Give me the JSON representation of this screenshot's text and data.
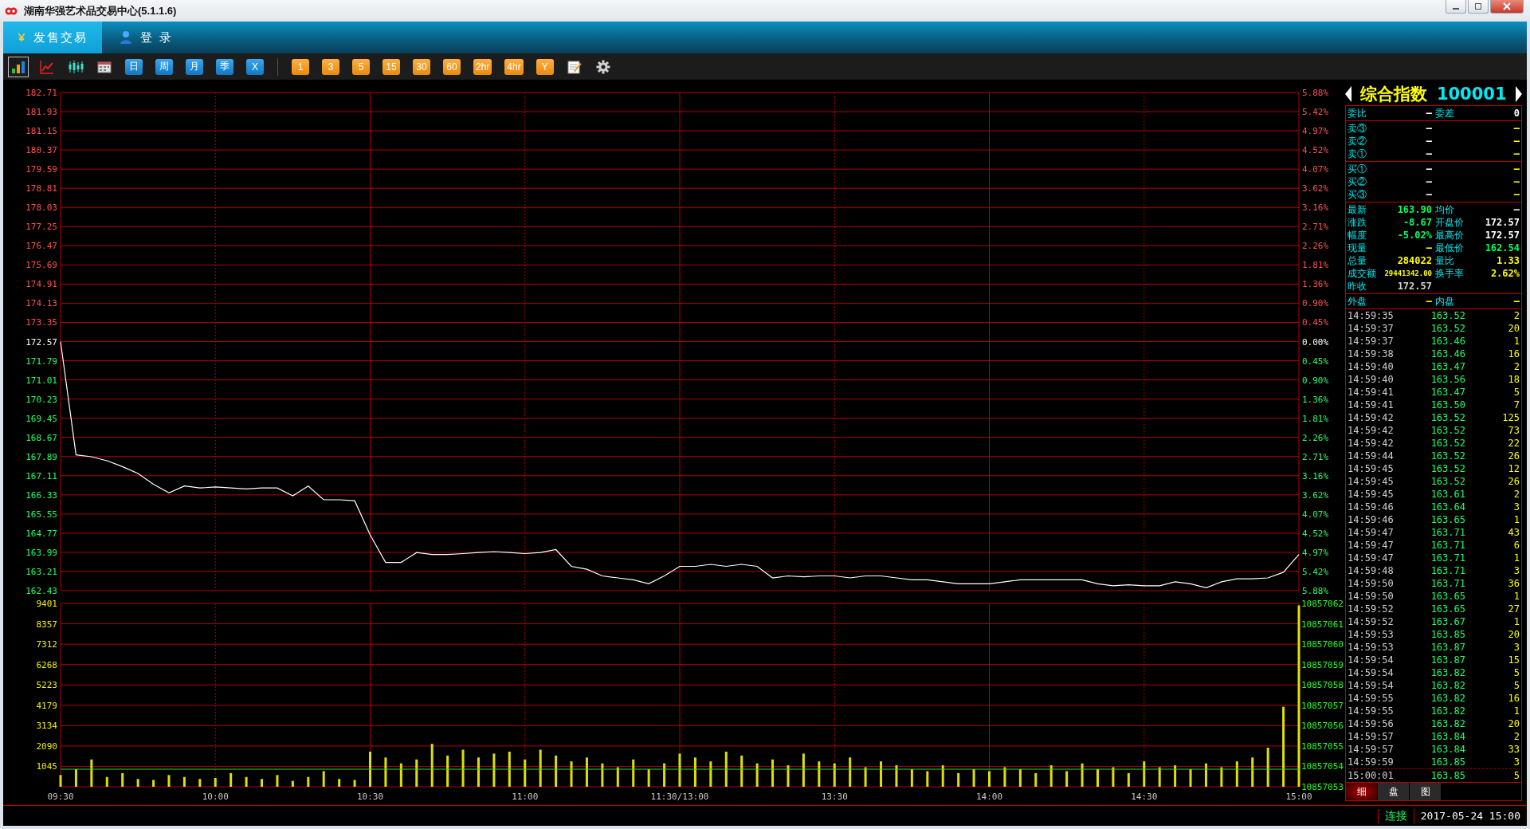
{
  "window": {
    "title": "湖南华强艺术品交易中心(5.1.1.6)"
  },
  "tabs": [
    {
      "label": "发售交易",
      "kind": "yen",
      "selected": true
    },
    {
      "label": "登 录",
      "kind": "user",
      "selected": false
    }
  ],
  "toolbar": {
    "tools": [
      {
        "kind": "bars",
        "selected": true
      },
      {
        "kind": "line",
        "selected": false
      },
      {
        "kind": "candles",
        "selected": false
      },
      {
        "kind": "calendar",
        "selected": false
      }
    ],
    "periods": [
      {
        "label": "日",
        "kind": "blue"
      },
      {
        "label": "周",
        "kind": "blue"
      },
      {
        "label": "月",
        "kind": "blue"
      },
      {
        "label": "季",
        "kind": "blue"
      },
      {
        "label": "X",
        "kind": "blue"
      },
      {
        "label": "1",
        "kind": "orange"
      },
      {
        "label": "3",
        "kind": "orange"
      },
      {
        "label": "5",
        "kind": "orange"
      },
      {
        "label": "15",
        "kind": "orange"
      },
      {
        "label": "30",
        "kind": "orange"
      },
      {
        "label": "60",
        "kind": "orange"
      },
      {
        "label": "2hr",
        "kind": "orange"
      },
      {
        "label": "4hr",
        "kind": "orange"
      },
      {
        "label": "Y",
        "kind": "orange"
      }
    ],
    "extras": [
      {
        "kind": "note"
      },
      {
        "kind": "gear"
      }
    ]
  },
  "price_chart": {
    "right_axis": [
      "5.88%",
      "5.42%",
      "4.97%",
      "4.52%",
      "4.07%",
      "3.62%",
      "3.16%",
      "2.71%",
      "2.26%",
      "1.81%",
      "1.36%",
      "0.90%",
      "0.45%",
      "0.00%",
      "0.45%",
      "0.90%",
      "1.36%",
      "1.81%",
      "2.26%",
      "2.71%",
      "3.16%",
      "3.62%",
      "4.07%",
      "4.52%",
      "4.97%",
      "5.42%",
      "5.88%"
    ],
    "chart_data": {
      "type": "line",
      "grid": true,
      "ylim": [
        162.43,
        182.71
      ],
      "yticks": [
        182.71,
        181.93,
        181.15,
        180.37,
        179.59,
        178.81,
        178.03,
        177.25,
        176.47,
        175.69,
        174.91,
        174.13,
        173.35,
        172.57,
        171.79,
        171.01,
        170.23,
        169.45,
        168.67,
        167.89,
        167.11,
        166.33,
        165.55,
        164.77,
        163.99,
        163.21,
        162.43
      ],
      "values": [
        172.57,
        167.96,
        167.88,
        167.72,
        167.48,
        167.2,
        166.76,
        166.41,
        166.69,
        166.61,
        166.65,
        166.61,
        166.57,
        166.61,
        166.61,
        166.29,
        166.69,
        166.13,
        166.13,
        166.09,
        164.7,
        163.58,
        163.58,
        163.98,
        163.9,
        163.9,
        163.94,
        163.98,
        164.02,
        163.98,
        163.94,
        163.98,
        164.1,
        163.42,
        163.3,
        163.03,
        162.95,
        162.87,
        162.71,
        163.03,
        163.42,
        163.42,
        163.5,
        163.42,
        163.5,
        163.42,
        162.95,
        163.03,
        162.99,
        163.03,
        163.03,
        162.95,
        163.03,
        163.03,
        162.95,
        162.87,
        162.87,
        162.79,
        162.71,
        162.71,
        162.71,
        162.79,
        162.87,
        162.87,
        162.87,
        162.87,
        162.87,
        162.71,
        162.63,
        162.67,
        162.63,
        162.63,
        162.79,
        162.71,
        162.55,
        162.79,
        162.91,
        162.91,
        162.95,
        163.18,
        163.9
      ]
    }
  },
  "volume_chart": {
    "right_axis": [
      "10857062",
      "10857061",
      "10857060",
      "10857059",
      "10857058",
      "10857057",
      "10857056",
      "10857055",
      "10857054",
      "10857053"
    ],
    "chart_data": {
      "type": "bar",
      "grid": true,
      "ylim": [
        0,
        9401
      ],
      "yticks": [
        9401,
        8357,
        7312,
        6268,
        5223,
        4179,
        3134,
        2090,
        1045
      ],
      "ref_lines": [
        {
          "axis": "y",
          "value": 900,
          "color": "#20e020"
        }
      ],
      "categories": [
        "09:30",
        null,
        null,
        null,
        null,
        null,
        null,
        null,
        null,
        null,
        "10:00",
        null,
        null,
        null,
        null,
        null,
        null,
        null,
        null,
        null,
        "10:30",
        null,
        null,
        null,
        null,
        null,
        null,
        null,
        null,
        null,
        "11:00",
        null,
        null,
        null,
        null,
        null,
        null,
        null,
        null,
        null,
        "11:30/13:00",
        null,
        null,
        null,
        null,
        null,
        null,
        null,
        null,
        null,
        "13:30",
        null,
        null,
        null,
        null,
        null,
        null,
        null,
        null,
        null,
        "14:00",
        null,
        null,
        null,
        null,
        null,
        null,
        null,
        null,
        null,
        "14:30",
        null,
        null,
        null,
        null,
        null,
        null,
        null,
        null,
        null,
        "15:00"
      ],
      "values": [
        600,
        900,
        1400,
        500,
        700,
        400,
        350,
        600,
        500,
        400,
        450,
        700,
        500,
        400,
        600,
        300,
        500,
        800,
        400,
        350,
        1800,
        1500,
        1200,
        1400,
        2200,
        1600,
        1900,
        1500,
        1700,
        1800,
        1400,
        1900,
        1600,
        1300,
        1500,
        1200,
        1000,
        1400,
        900,
        1200,
        1700,
        1500,
        1300,
        1800,
        1600,
        1200,
        1400,
        1100,
        1700,
        1300,
        1200,
        1500,
        1000,
        1300,
        1100,
        900,
        800,
        1100,
        700,
        900,
        800,
        1000,
        900,
        700,
        1100,
        800,
        1200,
        900,
        1000,
        700,
        1300,
        1000,
        1100,
        900,
        1200,
        1000,
        1300,
        1500,
        2000,
        4100,
        9300
      ]
    }
  },
  "quote": {
    "name": "综合指数",
    "code": "100001",
    "sections": [
      [
        {
          "label": "委比",
          "value": {
            "text": "—",
            "color": "#ffffff"
          },
          "label2": "委差",
          "value2": {
            "text": "0",
            "color": "#ffffff"
          }
        }
      ],
      [
        {
          "label": "卖③",
          "value": {
            "text": "—",
            "color": "#ffffff"
          },
          "value2": {
            "text": "—",
            "color": "#ffff00"
          }
        },
        {
          "label": "卖②",
          "value": {
            "text": "—",
            "color": "#ffffff"
          },
          "value2": {
            "text": "—",
            "color": "#ffff00"
          }
        },
        {
          "label": "卖①",
          "value": {
            "text": "—",
            "color": "#ffffff"
          },
          "value2": {
            "text": "—",
            "color": "#ffff00"
          }
        }
      ],
      [
        {
          "label": "买①",
          "value": {
            "text": "—",
            "color": "#ffffff"
          },
          "value2": {
            "text": "—",
            "color": "#ffff00"
          }
        },
        {
          "label": "买②",
          "value": {
            "text": "—",
            "color": "#ffffff"
          },
          "value2": {
            "text": "—",
            "color": "#ffff00"
          }
        },
        {
          "label": "买③",
          "value": {
            "text": "—",
            "color": "#ffffff"
          },
          "value2": {
            "text": "—",
            "color": "#ffff00"
          }
        }
      ],
      [
        {
          "label": "最新",
          "value": {
            "text": "163.90",
            "color": "#00ff60"
          },
          "label2": "均价",
          "value2": {
            "text": "—",
            "color": "#ffffff"
          }
        },
        {
          "label": "涨跌",
          "value": {
            "text": "-8.67",
            "color": "#00ff60"
          },
          "label2": "开盘价",
          "value2": {
            "text": "172.57",
            "color": "#ffffff"
          }
        },
        {
          "label": "幅度",
          "value": {
            "text": "-5.02%",
            "color": "#00ff60"
          },
          "label2": "最高价",
          "value2": {
            "text": "172.57",
            "color": "#ffffff"
          }
        },
        {
          "label": "现量",
          "value": {
            "text": "—",
            "color": "#ffff00"
          },
          "label2": "最低价",
          "value2": {
            "text": "162.54",
            "color": "#00ff60"
          }
        },
        {
          "label": "总量",
          "value": {
            "text": "284022",
            "color": "#ffff00"
          },
          "label2": "量比",
          "value2": {
            "text": "1.33",
            "color": "#ffff00"
          }
        },
        {
          "label": "成交额",
          "kind": "small",
          "value": {
            "text": "29441342.00",
            "color": "#ffff00"
          },
          "label2": "换手率",
          "value2": {
            "text": "2.62%",
            "color": "#ffff00"
          }
        },
        {
          "label": "昨收",
          "value": {
            "text": "172.57",
            "color": "#d0d0d0"
          }
        }
      ],
      [
        {
          "label": "外盘",
          "value": {
            "text": "—",
            "color": "#ffff00"
          },
          "label2": "内盘",
          "value2": {
            "text": "—",
            "color": "#ffff00"
          }
        }
      ]
    ],
    "ticks": [
      {
        "time": "14:59:35",
        "price": "163.52",
        "volume": "2"
      },
      {
        "time": "14:59:37",
        "price": "163.52",
        "volume": "20"
      },
      {
        "time": "14:59:37",
        "price": "163.46",
        "volume": "1"
      },
      {
        "time": "14:59:38",
        "price": "163.46",
        "volume": "16"
      },
      {
        "time": "14:59:40",
        "price": "163.47",
        "volume": "2"
      },
      {
        "time": "14:59:40",
        "price": "163.56",
        "volume": "18"
      },
      {
        "time": "14:59:41",
        "price": "163.47",
        "volume": "5"
      },
      {
        "time": "14:59:41",
        "price": "163.50",
        "volume": "7"
      },
      {
        "time": "14:59:42",
        "price": "163.52",
        "volume": "125"
      },
      {
        "time": "14:59:42",
        "price": "163.52",
        "volume": "73"
      },
      {
        "time": "14:59:42",
        "price": "163.52",
        "volume": "22"
      },
      {
        "time": "14:59:44",
        "price": "163.52",
        "volume": "26"
      },
      {
        "time": "14:59:45",
        "price": "163.52",
        "volume": "12"
      },
      {
        "time": "14:59:45",
        "price": "163.52",
        "volume": "26"
      },
      {
        "time": "14:59:45",
        "price": "163.61",
        "volume": "2"
      },
      {
        "time": "14:59:46",
        "price": "163.64",
        "volume": "3"
      },
      {
        "time": "14:59:46",
        "price": "163.65",
        "volume": "1"
      },
      {
        "time": "14:59:47",
        "price": "163.71",
        "volume": "43"
      },
      {
        "time": "14:59:47",
        "price": "163.71",
        "volume": "6"
      },
      {
        "time": "14:59:47",
        "price": "163.71",
        "volume": "1"
      },
      {
        "time": "14:59:48",
        "price": "163.71",
        "volume": "3"
      },
      {
        "time": "14:59:50",
        "price": "163.71",
        "volume": "36"
      },
      {
        "time": "14:59:50",
        "price": "163.65",
        "volume": "1"
      },
      {
        "time": "14:59:52",
        "price": "163.65",
        "volume": "27"
      },
      {
        "time": "14:59:52",
        "price": "163.67",
        "volume": "1"
      },
      {
        "time": "14:59:53",
        "price": "163.85",
        "volume": "20"
      },
      {
        "time": "14:59:53",
        "price": "163.87",
        "volume": "3"
      },
      {
        "time": "14:59:54",
        "price": "163.87",
        "volume": "15"
      },
      {
        "time": "14:59:54",
        "price": "163.82",
        "volume": "5"
      },
      {
        "time": "14:59:54",
        "price": "163.82",
        "volume": "5"
      },
      {
        "time": "14:59:55",
        "price": "163.82",
        "volume": "16"
      },
      {
        "time": "14:59:55",
        "price": "163.82",
        "volume": "1"
      },
      {
        "time": "14:59:56",
        "price": "163.82",
        "volume": "20"
      },
      {
        "time": "14:59:57",
        "price": "163.84",
        "volume": "2"
      },
      {
        "time": "14:59:57",
        "price": "163.84",
        "volume": "33"
      },
      {
        "time": "14:59:59",
        "price": "163.85",
        "volume": "3"
      },
      {
        "time": "15:00:01",
        "price": "163.85",
        "volume": "5"
      }
    ],
    "tabs": [
      {
        "label": "细",
        "selected": true
      },
      {
        "label": "盘",
        "selected": false
      },
      {
        "label": "图",
        "selected": false
      }
    ]
  },
  "status_bar": {
    "connection": "连接",
    "datetime": "2017-05-24 15:00"
  }
}
